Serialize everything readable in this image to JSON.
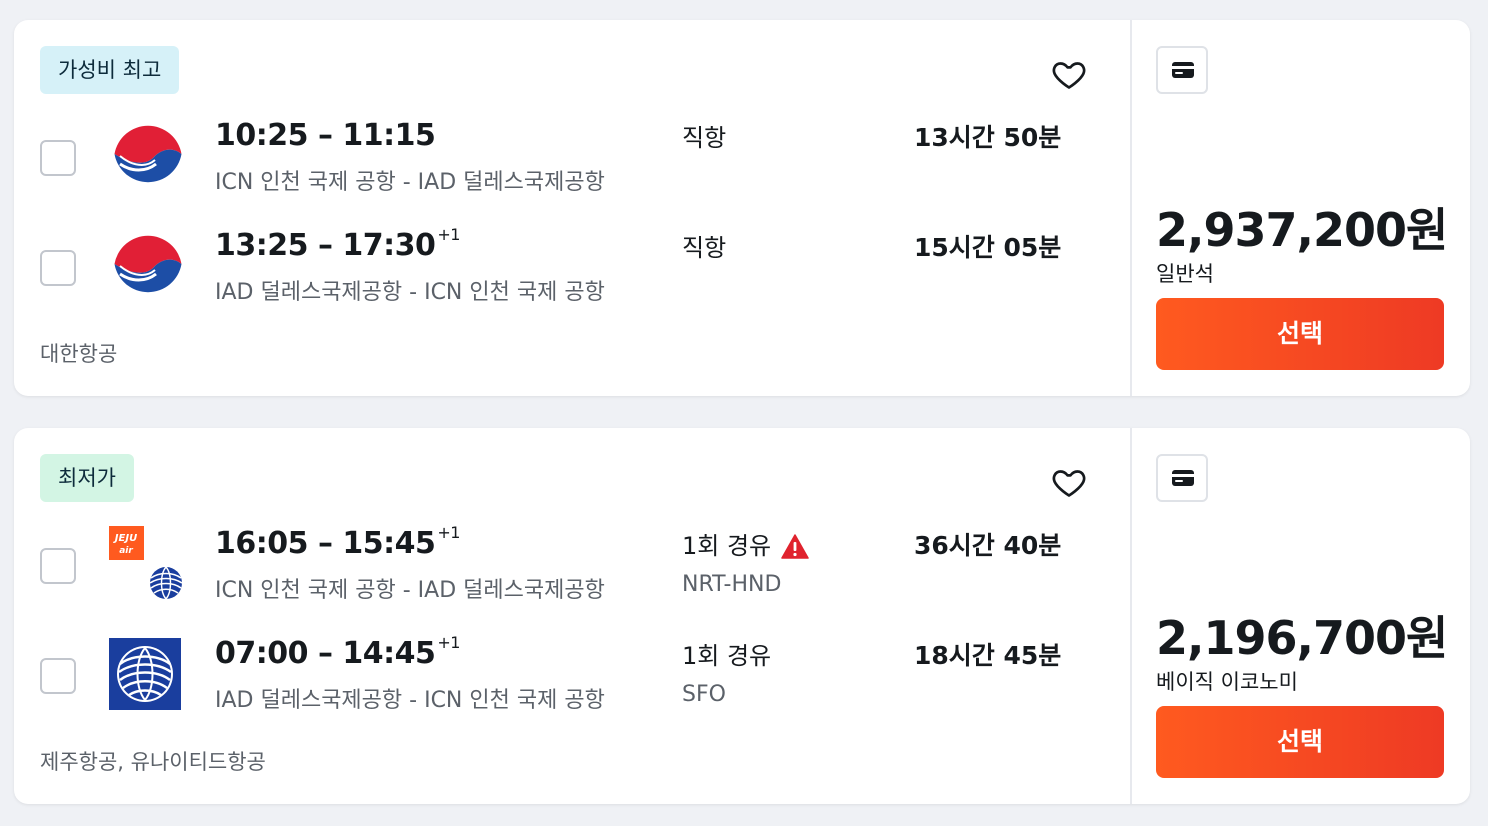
{
  "results": [
    {
      "badge": "가성비 최고",
      "legs": [
        {
          "time": "10:25 – 11:15",
          "day_offset": "",
          "route": "ICN 인천 국제 공항 - IAD 덜레스국제공항",
          "stops": "직항",
          "stops_detail": "",
          "duration": "13시간 50분",
          "logo": "korean-air-logo"
        },
        {
          "time": "13:25 – 17:30",
          "day_offset": "+1",
          "route": "IAD 덜레스국제공항 - ICN 인천 국제 공항",
          "stops": "직항",
          "stops_detail": "",
          "duration": "15시간 05분",
          "logo": "korean-air-logo"
        }
      ],
      "airlines": "대한항공",
      "price": "2,937,200원",
      "cabin": "일반석",
      "select_label": "선택"
    },
    {
      "badge": "최저가",
      "legs": [
        {
          "time": "16:05 – 15:45",
          "day_offset": "+1",
          "route": "ICN 인천 국제 공항 - IAD 덜레스국제공항",
          "stops": "1회 경유",
          "stops_detail": "NRT-HND",
          "duration": "36시간 40분",
          "logo": "jeju-united-logo",
          "jeju_logo_text": [
            "JEJU",
            "air"
          ]
        },
        {
          "time": "07:00 – 14:45",
          "day_offset": "+1",
          "route": "IAD 덜레스국제공항 - ICN 인천 국제 공항",
          "stops": "1회 경유",
          "stops_detail": "SFO",
          "duration": "18시간 45분",
          "logo": "united-logo"
        }
      ],
      "airlines": "제주항공, 유나이티드항공",
      "price": "2,196,700원",
      "cabin": "베이직 이코노미",
      "select_label": "선택"
    }
  ],
  "colors": {
    "accent": "#ff5a1f",
    "best_badge": "#d6f1f8",
    "cheapest_badge": "#d3f5e4",
    "warning": "#e0232e"
  },
  "icons": {
    "favorite": "heart-outline-icon",
    "payment": "credit-card-icon",
    "warning": "warning-triangle-icon"
  }
}
